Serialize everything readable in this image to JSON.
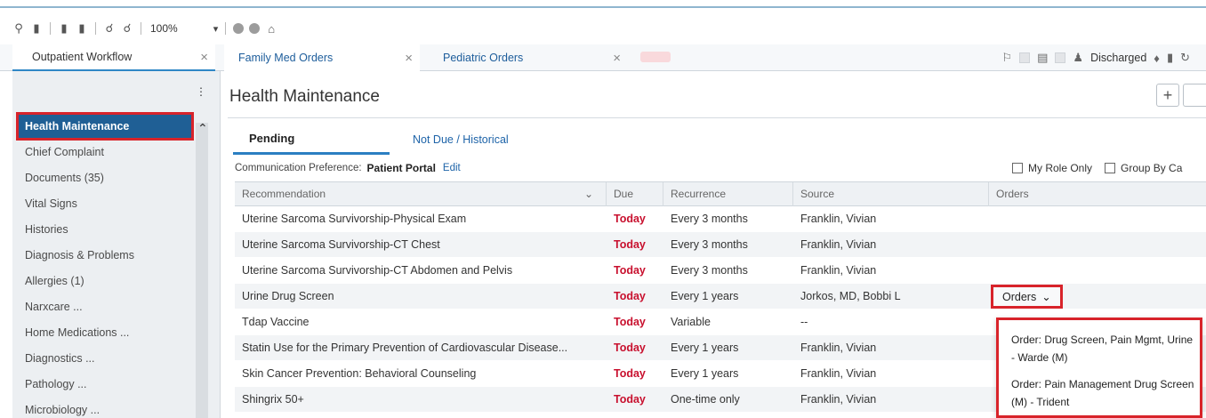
{
  "toolbar": {
    "zoom": "100%"
  },
  "tabs": {
    "workflow": "Outpatient Workflow",
    "family_med": "Family Med Orders",
    "pediatric": "Pediatric Orders",
    "close_glyph": "×"
  },
  "status": {
    "discharged": "Discharged"
  },
  "sidebar": {
    "items": [
      {
        "label": "Health Maintenance"
      },
      {
        "label": "Chief Complaint"
      },
      {
        "label": "Documents (35)"
      },
      {
        "label": "Vital Signs"
      },
      {
        "label": "Histories"
      },
      {
        "label": "Diagnosis & Problems"
      },
      {
        "label": "Allergies (1)"
      },
      {
        "label": "Narxcare ..."
      },
      {
        "label": "Home Medications ..."
      },
      {
        "label": "Diagnostics ..."
      },
      {
        "label": "Pathology ..."
      },
      {
        "label": "Microbiology ..."
      }
    ]
  },
  "main": {
    "title": "Health Maintenance",
    "tab_pending": "Pending",
    "tab_historical": "Not Due / Historical",
    "pref_label": "Communication Preference:",
    "pref_value": "Patient Portal",
    "pref_edit": "Edit",
    "filter_my_role": "My Role Only",
    "filter_group_by": "Group By Ca"
  },
  "table": {
    "headers": {
      "recommendation": "Recommendation",
      "due": "Due",
      "recurrence": "Recurrence",
      "source": "Source",
      "orders": "Orders"
    },
    "rows": [
      {
        "recommendation": "Uterine Sarcoma Survivorship-Physical Exam",
        "due": "Today",
        "recurrence": "Every 3 months",
        "source": "Franklin, Vivian",
        "orders": ""
      },
      {
        "recommendation": "Uterine Sarcoma Survivorship-CT Chest",
        "due": "Today",
        "recurrence": "Every 3 months",
        "source": "Franklin, Vivian",
        "orders": ""
      },
      {
        "recommendation": "Uterine Sarcoma Survivorship-CT Abdomen and Pelvis",
        "due": "Today",
        "recurrence": "Every 3 months",
        "source": "Franklin, Vivian",
        "orders": ""
      },
      {
        "recommendation": "Urine Drug Screen",
        "due": "Today",
        "recurrence": "Every 1 years",
        "source": "Jorkos, MD, Bobbi L",
        "orders": "Orders"
      },
      {
        "recommendation": "Tdap Vaccine",
        "due": "Today",
        "recurrence": "Variable",
        "source": "--",
        "orders": ""
      },
      {
        "recommendation": "Statin Use for the Primary Prevention of Cardiovascular Disease...",
        "due": "Today",
        "recurrence": "Every 1 years",
        "source": "Franklin, Vivian",
        "orders": ""
      },
      {
        "recommendation": "Skin Cancer Prevention: Behavioral Counseling",
        "due": "Today",
        "recurrence": "Every 1 years",
        "source": "Franklin, Vivian",
        "orders": ""
      },
      {
        "recommendation": "Shingrix 50+",
        "due": "Today",
        "recurrence": "One-time only",
        "source": "Franklin, Vivian",
        "orders": ""
      }
    ]
  },
  "orders_menu": {
    "items": [
      {
        "label": "Order: Drug Screen, Pain Mgmt, Urine - Warde (M)"
      },
      {
        "label": "Order: Pain Management Drug Screen (M) - Trident"
      }
    ]
  },
  "colors": {
    "accent": "#1f5f95",
    "highlight_outline": "#d8232a",
    "due_today": "#c8102e",
    "link": "#1d63a8"
  }
}
